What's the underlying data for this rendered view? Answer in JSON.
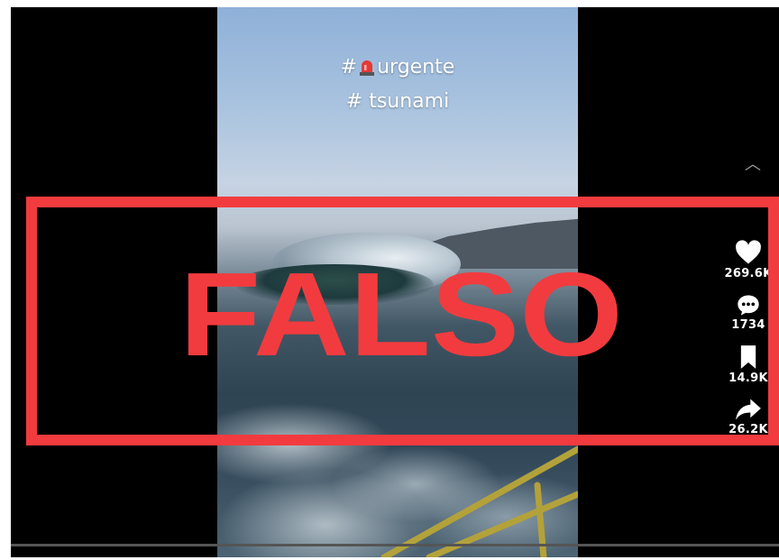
{
  "video": {
    "hashtag_line_1_prefix": "#",
    "hashtag_line_1_word": "urgente",
    "hashtag_line_2": "# tsunami"
  },
  "actions": {
    "likes": "269.6K",
    "comments": "1734",
    "saves": "14.9K",
    "shares": "26.2K"
  },
  "stamp": {
    "label": "FALSO",
    "color": "#f23b3f"
  },
  "icons": [
    "siren-icon",
    "chevron-up-icon",
    "heart-icon",
    "comment-icon",
    "bookmark-icon",
    "share-icon"
  ]
}
